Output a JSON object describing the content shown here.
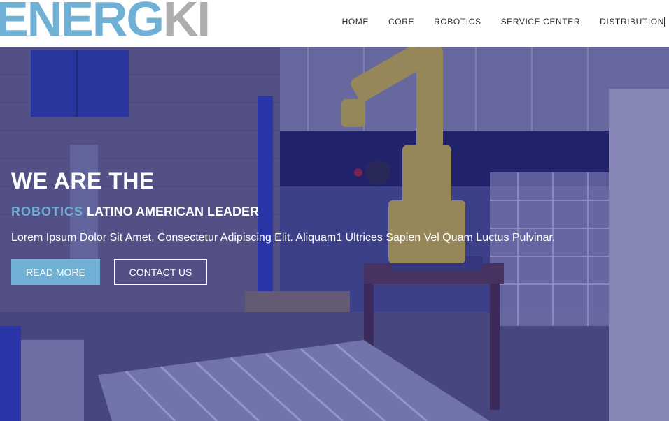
{
  "brand": {
    "logo_part1": "ENERG",
    "logo_part2": "KI"
  },
  "nav": {
    "items": [
      {
        "label": "HOME"
      },
      {
        "label": "CORE"
      },
      {
        "label": "ROBOTICS"
      },
      {
        "label": "SERVICE CENTER"
      },
      {
        "label": "DISTRIBUTION"
      }
    ]
  },
  "hero": {
    "title": "WE ARE THE",
    "subtitle_accent": "ROBOTICS",
    "subtitle_rest": " LATINO AMERICAN LEADER",
    "text": "Lorem Ipsum Dolor Sit Amet, Consectetur Adipiscing Elit. Aliquam1 Ultrices Sapien Vel Quam Luctus Pulvinar.",
    "read_more_label": "READ MORE",
    "contact_label": "CONTACT US"
  },
  "colors": {
    "accent": "#6fb0d4",
    "logo_gray": "#adadb0",
    "overlay": "#282882"
  }
}
